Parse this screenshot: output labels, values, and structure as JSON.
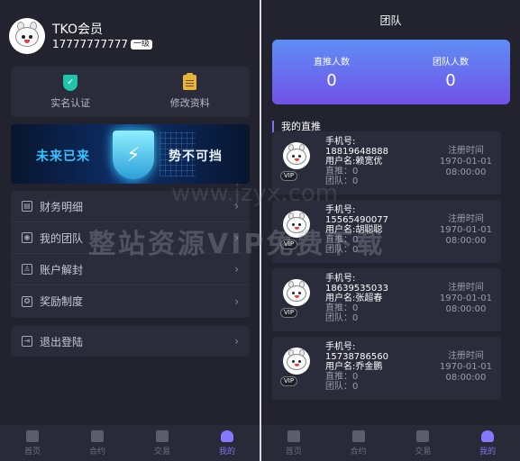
{
  "left": {
    "profile": {
      "name": "TKO会员",
      "phone": "17777777777",
      "level": "一级"
    },
    "quick_actions": [
      {
        "label": "实名认证",
        "icon": "shield-icon"
      },
      {
        "label": "修改资料",
        "icon": "clipboard-icon"
      }
    ],
    "banner": {
      "text_left": "未来已来",
      "text_right": "势不可挡"
    },
    "menu": [
      {
        "label": "财务明细",
        "icon": "chart-icon"
      },
      {
        "label": "我的团队",
        "icon": "team-icon"
      },
      {
        "label": "账户解封",
        "icon": "user-icon"
      },
      {
        "label": "奖励制度",
        "icon": "award-icon"
      }
    ],
    "logout": {
      "label": "退出登陆",
      "icon": "logout-icon"
    },
    "tabs": [
      {
        "label": "首页",
        "active": false
      },
      {
        "label": "合约",
        "active": false
      },
      {
        "label": "交易",
        "active": false
      },
      {
        "label": "我的",
        "active": true
      }
    ]
  },
  "right": {
    "title": "团队",
    "stats": [
      {
        "label": "直推人数",
        "value": "0"
      },
      {
        "label": "团队人数",
        "value": "0"
      }
    ],
    "section_title": "我的直推",
    "members": [
      {
        "phone_label": "手机号:",
        "phone": "18819648888",
        "username_label": "用户名:",
        "username": "赖宽优",
        "direct": "直推：0",
        "team": "团队：0",
        "date_label": "注册时间",
        "date": "1970-01-01",
        "time": "08:00:00",
        "badge": "VIP"
      },
      {
        "phone_label": "手机号:",
        "phone": "15565490077",
        "username_label": "用户名:",
        "username": "胡聪聪",
        "direct": "直推：0",
        "team": "团队：0",
        "date_label": "注册时间",
        "date": "1970-01-01",
        "time": "08:00:00",
        "badge": "VIP"
      },
      {
        "phone_label": "手机号:",
        "phone": "18639535033",
        "username_label": "用户名:",
        "username": "张超春",
        "direct": "直推：0",
        "team": "团队：0",
        "date_label": "注册时间",
        "date": "1970-01-01",
        "time": "08:00:00",
        "badge": "VIP"
      },
      {
        "phone_label": "手机号:",
        "phone": "15738786560",
        "username_label": "用户名:",
        "username": "乔金鹏",
        "direct": "直推：0",
        "team": "团队：0",
        "date_label": "注册时间",
        "date": "1970-01-01",
        "time": "08:00:00",
        "badge": "VIP"
      }
    ],
    "tabs": [
      {
        "label": "首页",
        "active": false
      },
      {
        "label": "合约",
        "active": false
      },
      {
        "label": "交易",
        "active": false
      },
      {
        "label": "我的",
        "active": true
      }
    ]
  },
  "watermark": {
    "text": "整站资源VIP免费下载",
    "url_text": "www.jzyx.com"
  }
}
